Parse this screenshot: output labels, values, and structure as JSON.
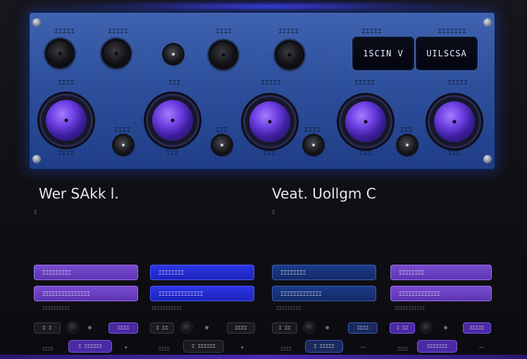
{
  "panel": {
    "top_labels": [
      "ΞΞΞΞΞ",
      "ΞΞΞΞΞ",
      "ΞΞΞΞ",
      "ΞΞΞΞΞ",
      "ΞΞΞΞΞ",
      "ΞΞΞΞΞΞΞ"
    ],
    "mid_labels": [
      "ΞΞΞΞ",
      "ΞΞΞ",
      "ΞΞΞΞΞ",
      "ΞΞΞΞΞ",
      "ΞΞΞΞΞ"
    ],
    "knob_sub_labels": [
      "ΞΞΞΞ",
      "ΞΞΞ",
      "ΞΞΞ",
      "ΞΞΞ",
      "ΞΞΞ"
    ],
    "small_knob_labels": [
      "ΞΞΞΞ",
      "ΞΞΞ",
      "ΞΞΞΞ",
      "ΞΞΞ"
    ],
    "display_left": "1SCIN V",
    "display_right": "UILSCSA"
  },
  "left": {
    "title": "Wer SAkk l.",
    "paragraph": "Ξ",
    "buttons": [
      "ΞΞΞΞΞΞΞΞΞ",
      "ΞΞΞΞΞΞΞΞ",
      "ΞΞΞΞΞΞΞΞΞΞΞΞΞΞΞ",
      "ΞΞΞΞΞΞΞΞΞΞΞΞΞΞ"
    ],
    "captions": [
      "ΞΞΞΞΞΞΞΞΞΞ",
      "ΞΞΞΞΞΞΞΞΞΞΞ"
    ],
    "pills": [
      "Ξ Ξ",
      "ΞΞΞΞ",
      "Ξ ΞΞ",
      "ΞΞΞΞ"
    ],
    "bottom_items": [
      "ΞΞΞΞ",
      "Ξ ΞΞΞΞΞΞ",
      "ΞΞΞΞ",
      "Ξ ΞΞΞΞΞΞ"
    ]
  },
  "right": {
    "title": "Veat. Uollgm C",
    "paragraph": "Ξ",
    "buttons": [
      "ΞΞΞΞΞΞΞΞ",
      "ΞΞΞΞΞΞΞΞ",
      "ΞΞΞΞΞΞΞΞΞΞΞΞΞ",
      "ΞΞΞΞΞΞΞΞΞΞΞΞΞ"
    ],
    "captions": [
      "ΞΞΞΞΞΞΞΞΞ",
      "ΞΞΞΞΞΞΞΞΞΞΞ"
    ],
    "pills": [
      "Ξ ΞΞ",
      "ΞΞΞΞ",
      "Ξ ΞΞ",
      "ΞΞΞΞΞ"
    ],
    "bottom_items": [
      "ΞΞΞΞ",
      "Ξ ΞΞΞΞΞ",
      "ΞΞΞΞ",
      "ΞΞΞΞΞΞΞ"
    ]
  },
  "colors": {
    "accent_purple": "#6b3de0",
    "accent_blue": "#2c36e8",
    "panel_blue": "#2c4f9c",
    "navy": "#1c3c8c"
  }
}
